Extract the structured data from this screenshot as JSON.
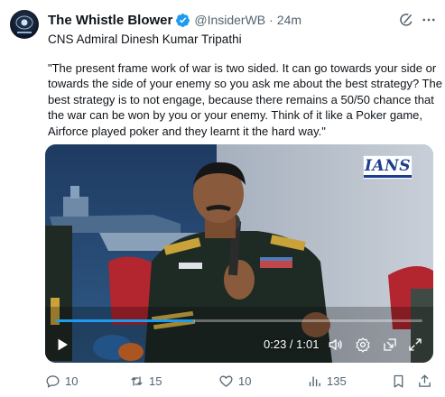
{
  "tweet": {
    "author_name": "The Whistle Blower",
    "handle": "@InsiderWB",
    "separator": "·",
    "time": "24m",
    "subtitle": "CNS Admiral Dinesh Kumar Tripathi",
    "quote_lines": [
      "\"The present frame work of war is two sided. It can go towards your side or",
      "towards the side of your enemy so you ask me about the best strategy? The",
      "best strategy is to not engage, because there remains a 50/50 chance that",
      "the war can be won by you or your enemy. Think of it like a Poker game,",
      "Airforce played poker and they learnt it the hard way.\""
    ]
  },
  "video": {
    "logo_text": "IANS",
    "timecode": "0:23 / 1:01",
    "progress_fraction": 0.377
  },
  "actions": {
    "replies": "10",
    "reposts": "15",
    "likes": "10",
    "views": "135"
  },
  "colors": {
    "verified": "#1d9bf0",
    "muted": "#536471",
    "accent": "#1d9bf0"
  },
  "icons": [
    "verified-badge-icon",
    "grok-icon",
    "more-icon",
    "play-icon",
    "volume-icon",
    "settings-icon",
    "pip-icon",
    "fullscreen-icon",
    "reply-icon",
    "repost-icon",
    "like-icon",
    "views-icon",
    "bookmark-icon",
    "share-icon"
  ]
}
